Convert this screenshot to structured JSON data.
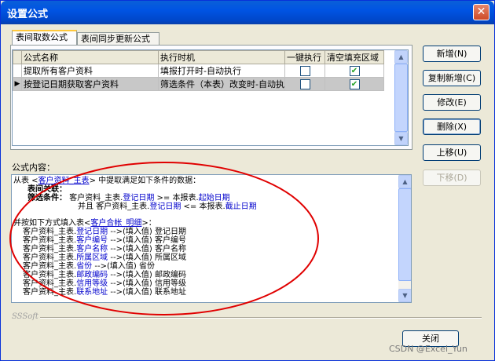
{
  "window": {
    "title": "设置公式",
    "close_glyph": "✕"
  },
  "tabs": [
    "表间取数公式",
    "表间同步更新公式"
  ],
  "grid": {
    "columns": [
      "公式名称",
      "执行时机",
      "一键执行",
      "清空填充区域"
    ],
    "rows": [
      {
        "name": "提取所有客户资料",
        "timing": "填报打开时-自动执行",
        "one_click": false,
        "clear_fill": true,
        "selected": false
      },
      {
        "name": "按登记日期获取客户资料",
        "timing": "筛选条件（本表）改变时-自动执",
        "one_click": false,
        "clear_fill": true,
        "selected": true
      }
    ],
    "row_marker": "▶"
  },
  "buttons": {
    "add": "新增(N)",
    "copy_add": "复制新增(C)",
    "edit": "修改(E)",
    "delete": "删除(X)",
    "move_up": "上移(U)",
    "move_down": "下移(D)",
    "close": "关闭"
  },
  "formula": {
    "label": "公式内容：",
    "line1_a": "从表 <",
    "line1_table": "客户资料_主表",
    "line1_b": "> 中提取满足如下条件的数据：",
    "line2": "表间关联：",
    "line3_label": "筛选条件：",
    "line3_a": " 客户资料_主表.",
    "line3_field": "登记日期",
    "line3_b": " >= 本报表.",
    "line3_param": "起始日期",
    "line4_a": "并且 客户资料_主表.",
    "line4_field": "登记日期",
    "line4_b": " <= 本报表.",
    "line4_param": "截止日期",
    "fill_a": "并按如下方式填入表<",
    "fill_table": "客户合帐_明细",
    "fill_b": ">：",
    "mappings": [
      {
        "src": "客户资料_主表.",
        "field": "登记日期",
        "arrow": " -->(填入值) ",
        "dest": "登记日期"
      },
      {
        "src": "客户资料_主表.",
        "field": "客户编号",
        "arrow": " -->(填入值) ",
        "dest": "客户编号"
      },
      {
        "src": "客户资料_主表.",
        "field": "客户名称",
        "arrow": " -->(填入值) ",
        "dest": "客户名称"
      },
      {
        "src": "客户资料_主表.",
        "field": "所属区域",
        "arrow": " -->(填入值) ",
        "dest": "所属区域"
      },
      {
        "src": "客户资料_主表.",
        "field": "省份",
        "arrow": " -->(填入值) ",
        "dest": "省份"
      },
      {
        "src": "客户资料_主表.",
        "field": "邮政编码",
        "arrow": " -->(填入值) ",
        "dest": "邮政编码"
      },
      {
        "src": "客户资料_主表.",
        "field": "信用等级",
        "arrow": " -->(填入值) ",
        "dest": "信用等级"
      },
      {
        "src": "客户资料_主表.",
        "field": "联系地址",
        "arrow": " -->(填入值) ",
        "dest": "联系地址"
      }
    ]
  },
  "footer": {
    "brand": "SSSoft"
  },
  "watermark": "CSDN @Excel_Yun",
  "colors": {
    "title_bar": "#0054e3",
    "annotation_ellipse": "#e00000",
    "link_blue": "#0000cc",
    "check_green": "#21a121"
  }
}
